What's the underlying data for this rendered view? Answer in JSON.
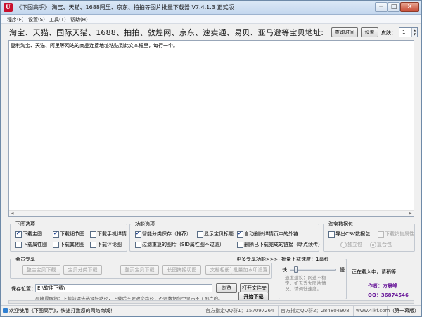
{
  "window": {
    "title": "《下图高手》 淘宝、天猫、1688阿里、京东、拍拍等图片批量下载器 V7.4.1.3 正式版",
    "app_icon_glyph": "U",
    "minimize_glyph": "─",
    "maximize_glyph": "□",
    "close_glyph": "✕"
  },
  "menu": {
    "items": [
      "程序(F)",
      "设置(S)",
      "工具(T)",
      "帮助(H)"
    ]
  },
  "address": {
    "label": "淘宝、天猫、国际天猫、1688、拍拍、敦煌网、京东、速卖通、易贝、亚马逊等宝贝地址:",
    "query_button": "查询时间",
    "settings_button": "设置",
    "skin_label": "皮肤：",
    "skin_value": "1"
  },
  "url_box": {
    "hint": "复制淘宝、天猫、阿里等网站的商品连接地址粘贴到此文本框里，每行一个。"
  },
  "download_options": {
    "title": "下图选项",
    "items": [
      {
        "label": "下载主图",
        "checked": true
      },
      {
        "label": "下载细节图",
        "checked": true
      },
      {
        "label": "下载手机详情",
        "checked": false
      },
      {
        "label": "下载属性图",
        "checked": false
      },
      {
        "label": "下载其他图",
        "checked": false
      },
      {
        "label": "下载评论图",
        "checked": false
      }
    ]
  },
  "function_options": {
    "title": "功能选项",
    "items": [
      {
        "label": "智能分类保存（推荐）",
        "checked": true
      },
      {
        "label": "显示宝贝标题",
        "checked": false
      },
      {
        "label": "自动删除详情页中的外链",
        "checked": true
      },
      {
        "label": "过滤重复的图片（SID属性图不过滤）",
        "checked": false
      },
      {
        "label": "删除已下载完成的链接（断点续传）",
        "checked": false
      }
    ]
  },
  "taobao_package": {
    "title": "淘宝数据包",
    "export_csv": "导出CSV数据包",
    "download_sales_attr": "下载销售属性",
    "radio_single": "独立包",
    "radio_merge": "复合包"
  },
  "member": {
    "title": "会员专享",
    "more_link": "更多专享功能>>>",
    "buttons": [
      "整店宝贝下载",
      "宝贝分类下载",
      "整页宝贝下载",
      "长图拼接切图",
      "文档相册下图",
      "批量加水印设置"
    ]
  },
  "speed": {
    "title": "批量下载速度：1毫秒",
    "slow": "快",
    "fast": "慢",
    "note": "速度建议：网速不稳定，如无丢失图片情况，请调低速度。",
    "value_fraction": 0.1
  },
  "status_right": {
    "loading": "正在载入中，请稍等......",
    "author": "作者：方晨峰",
    "qq": "QQ：36874546"
  },
  "save": {
    "label": "保存位置：",
    "path": "E:\\软件下载\\",
    "browse_button": "浏览",
    "open_folder_button": "打开文件夹",
    "warning": "晨峰提醒您：下载前请先选择好路径，下载后不要改变路径，否则数据包中显示不了图片的。",
    "start_button": "开始下载"
  },
  "statusbar": {
    "welcome": "欢迎使用《下图高手》，快速打造您的网络商城！",
    "qq_group1": "官方指定QQ群1：157097264",
    "qq_group2": "官方指定QQ群2：284804908",
    "site": "www.4lkf.com",
    "page": "（第一幕版）"
  },
  "colors": {
    "accent_purple": "#6a1a9a",
    "author_blue": "#1b3fa0",
    "note_gray": "#8a8a8a"
  }
}
